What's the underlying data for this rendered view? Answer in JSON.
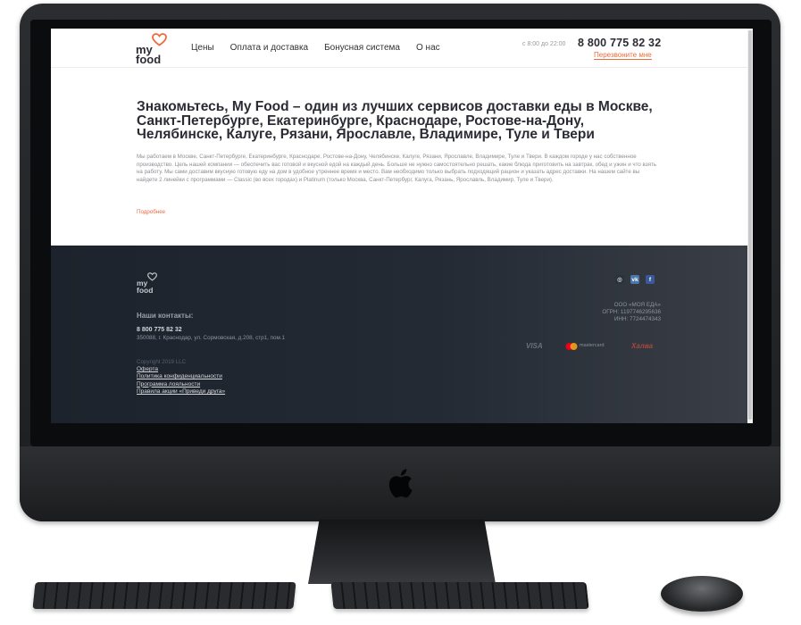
{
  "site": {
    "logo": {
      "line1": "my",
      "line2": "food"
    },
    "nav": [
      {
        "label": "Цены"
      },
      {
        "label": "Оплата и доставка"
      },
      {
        "label": "Бонусная система"
      },
      {
        "label": "О нас"
      }
    ],
    "hours": "с 8:00 до 22:00",
    "phone": "8 800 775 82 32",
    "callback": "Перезвоните мне"
  },
  "main": {
    "title": "Знакомьтесь, My Food – один из лучших сервисов доставки еды в Москве, Санкт-Петербурге, Екатеринбурге, Краснодаре, Ростове-на-Дону, Челябинске, Калуге, Рязани, Ярославле, Владимире, Туле и Твери",
    "text": "Мы работаем в Москве, Санкт-Петербурге, Екатеринбурге, Краснодаре, Ростове-на-Дону, Челябинске, Калуге, Рязани, Ярославле, Владимире, Туле и Твери. В каждом городе у нас собственное производство. Цель нашей компании — обеспечить вас готовой и вкусной едой на каждый день. Больше не нужно самостоятельно решать, какие блюда приготовить на завтрак, обед и ужин и что взять на работу. Мы сами доставим вкусную готовую еду на дом в удобное утреннее время и место. Вам необходимо только выбрать подходящий рацион и указать адрес доставки. На нашем сайте вы найдете 2 линейки с программами — Classic (во всех городах) и Platinum (только Москва, Санкт-Петербург, Калуга, Рязань, Ярославль, Владимир, Туле и Твери).",
    "more": "Подробнее"
  },
  "footer": {
    "logo": {
      "line1": "my",
      "line2": "food"
    },
    "contacts_title": "Наши контакты:",
    "phone": "8 800 775 82 32",
    "address": "350088, г. Краснодар, ул. Сормовская, д.208, стр1, пом.1",
    "copyright": "Copyright 2019 LLC",
    "links": [
      {
        "label": "Оферта"
      },
      {
        "label": "Политика конфиденциальности"
      },
      {
        "label": "Программа лояльности"
      },
      {
        "label": "Правила акции «Приведи друга»"
      }
    ],
    "socials": [
      {
        "icon": "instagram-icon",
        "glyph": "◎"
      },
      {
        "icon": "vk-icon",
        "glyph": "vk"
      },
      {
        "icon": "facebook-icon",
        "glyph": "f"
      }
    ],
    "company": {
      "name": "ООО «МОЯ ЕДА»",
      "ogrn": "ОГРН: 1197746295636",
      "inn": "ИНН: 7724474343"
    },
    "payments": {
      "visa": "VISA",
      "mastercard": "mastercard",
      "halva": "Халва"
    }
  },
  "colors": {
    "accent": "#ef6a3a",
    "footer_bg": "#1d232c",
    "text_dark": "#2a2b33"
  }
}
